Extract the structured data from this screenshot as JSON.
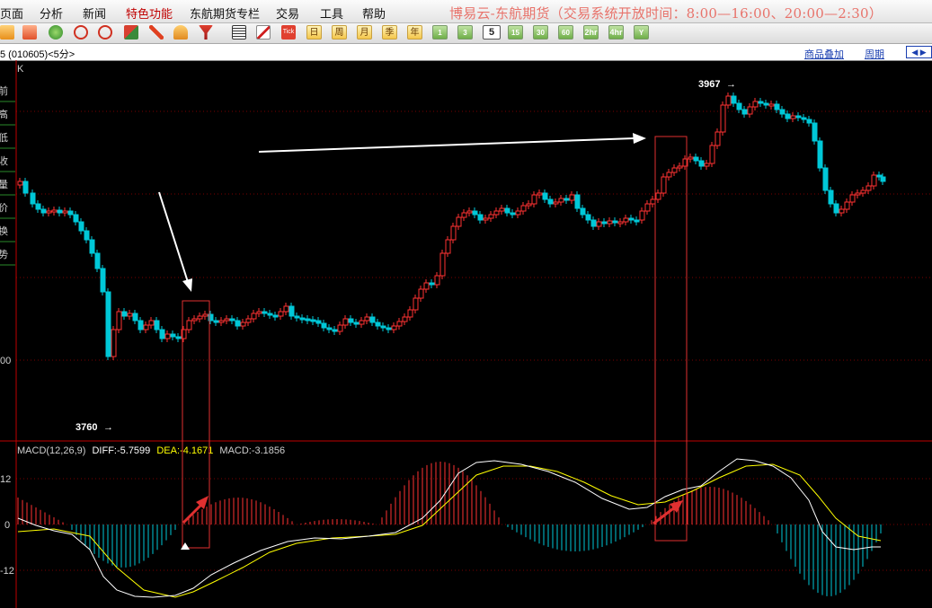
{
  "menu": {
    "items": [
      "页面",
      "分析",
      "新闻",
      "特色功能",
      "东航期货专栏",
      "交易",
      "工具",
      "帮助"
    ],
    "active_index": 3,
    "banner": "博易云-东航期货（交易系统开放时间：8:00—16:00、20:00—2:30）"
  },
  "toolbar": {
    "tick_label": "Tick",
    "periods": [
      "日",
      "周",
      "月",
      "季",
      "年"
    ],
    "minutes": [
      "1",
      "3",
      "5",
      "15",
      "30",
      "60",
      "2hr",
      "4hr",
      "Y"
    ],
    "selected_minute": "5"
  },
  "subbar": {
    "code_text": "5 (010605)<5分>",
    "overlay_link": "商品叠加",
    "period_link": "周期"
  },
  "main": {
    "k_label": "K",
    "left_panel_chars": [
      "前",
      "高",
      "低",
      "收",
      "量",
      "价",
      "换",
      "势"
    ],
    "price_axis_label": "00",
    "high_label": "3967",
    "low_label": "3760"
  },
  "macd": {
    "title": "MACD(12,26,9)",
    "diff_text": "DIFF:-5.7599",
    "dea_text": "DEA:-4.1671",
    "macd_text": "MACD:-3.1856",
    "axis_labels": [
      "12",
      "0",
      "-12"
    ]
  },
  "colors": {
    "up": "#ff3232",
    "down": "#00c8d8",
    "diff": "#ffffff",
    "dea": "#ffff00",
    "grid": "#7a0000",
    "banner": "#e8736b"
  },
  "chart_data": {
    "type": "candlestick+macd",
    "highest_marked": 3967,
    "lowest_marked": 3760,
    "macd_axis_ticks": [
      12,
      0,
      -12
    ],
    "indicator_values": {
      "DIFF": -5.7599,
      "DEA": -4.1671,
      "MACD": -3.1856
    }
  }
}
